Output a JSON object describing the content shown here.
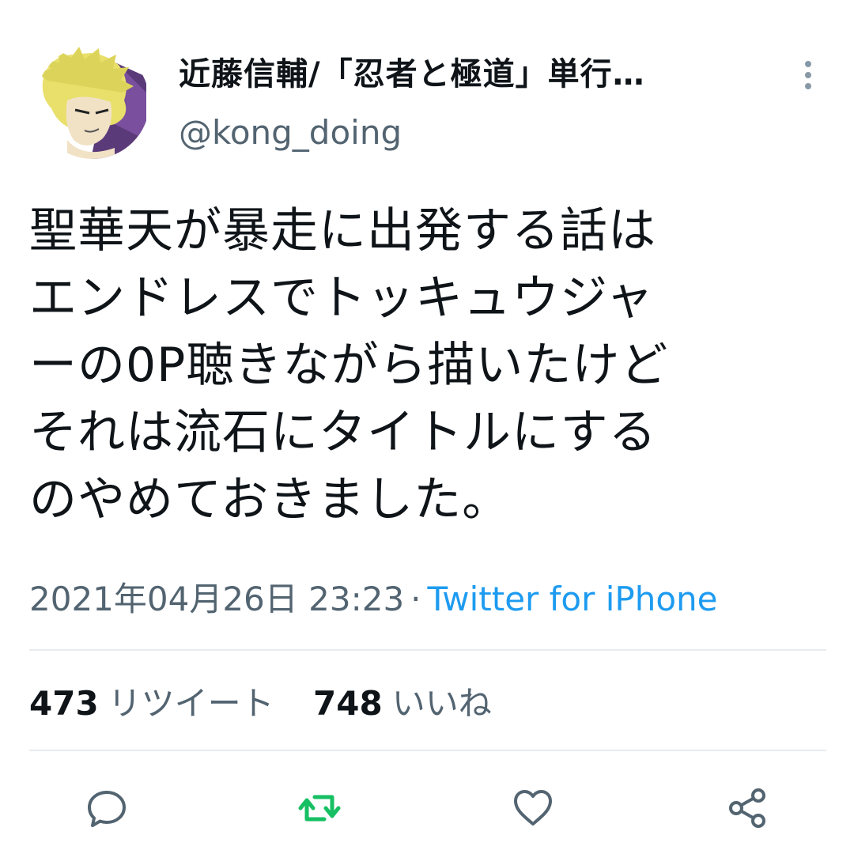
{
  "tweet": {
    "display_name": "近藤信輔/「忍者と極道」単行…",
    "handle": "@kong_doing",
    "text": "聖華天が暴走に出発する話は\nエンドレスでトッキュウジャ\nーの0P聴きながら描いたけど\nそれは流石にタイトルにする\nのやめておきました。",
    "timestamp": "2021年04月26日 23:23",
    "separator": "·",
    "source": "Twitter for iPhone"
  },
  "stats": {
    "retweets_count": "473",
    "retweets_label": "リツイート",
    "likes_count": "748",
    "likes_label": "いいね"
  },
  "icons": {
    "more": "more-vertical-icon",
    "reply": "reply-icon",
    "retweet": "retweet-icon",
    "like": "heart-icon",
    "share": "share-icon"
  },
  "colors": {
    "text": "#0f1419",
    "secondary": "#536471",
    "link": "#1d9bf0",
    "retweet_green": "#17bf63",
    "divider": "#e6ecf0"
  }
}
